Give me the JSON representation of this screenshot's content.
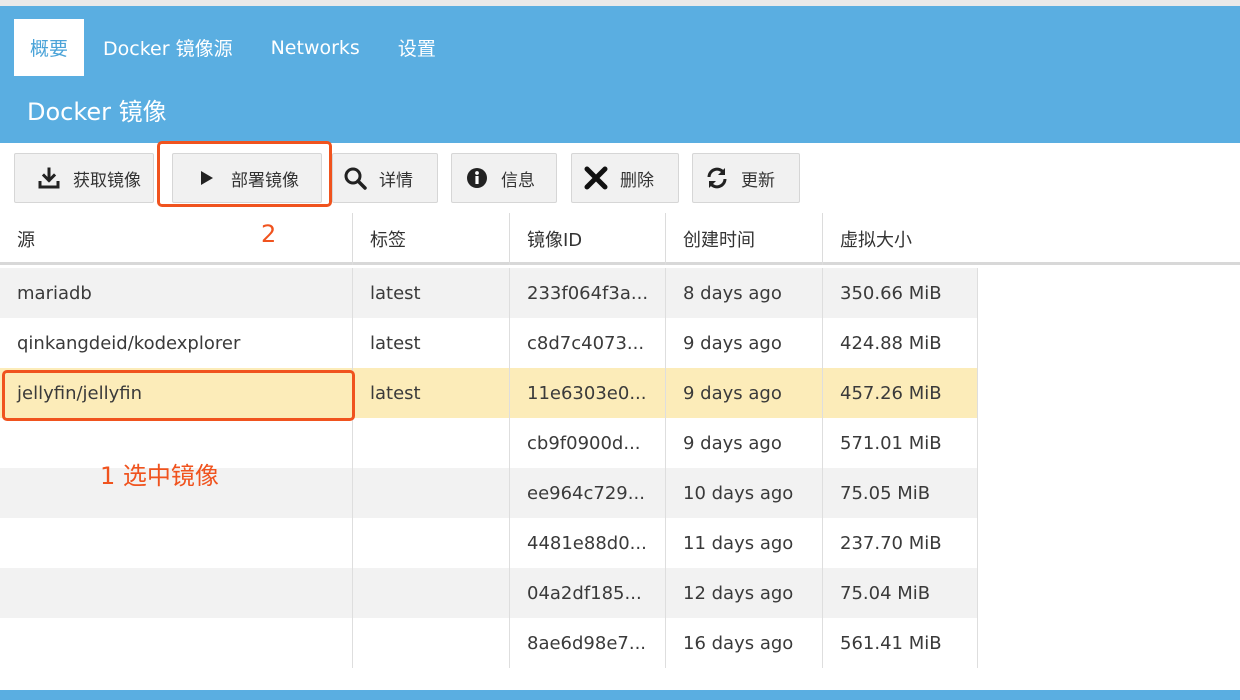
{
  "tabs": [
    {
      "label": "概要",
      "active": true
    },
    {
      "label": "Docker 镜像源",
      "active": false
    },
    {
      "label": "Networks",
      "active": false
    },
    {
      "label": "设置",
      "active": false
    }
  ],
  "header": {
    "title": "Docker 镜像"
  },
  "toolbar": {
    "pull_label": "获取镜像",
    "deploy_label": "部署镜像",
    "details_label": "详情",
    "info_label": "信息",
    "delete_label": "删除",
    "update_label": "更新"
  },
  "table": {
    "columns": [
      "源",
      "标签",
      "镜像ID",
      "创建时间",
      "虚拟大小"
    ],
    "rows": [
      {
        "source": "mariadb",
        "tag": "latest",
        "id": "233f064f3a...",
        "created": "8 days ago",
        "size": "350.66 MiB",
        "selected": false
      },
      {
        "source": "qinkangdeid/kodexplorer",
        "tag": "latest",
        "id": "c8d7c4073...",
        "created": "9 days ago",
        "size": "424.88 MiB",
        "selected": false
      },
      {
        "source": "jellyfin/jellyfin",
        "tag": "latest",
        "id": "11e6303e0...",
        "created": "9 days ago",
        "size": "457.26 MiB",
        "selected": true
      },
      {
        "source": "",
        "tag": "",
        "id": "cb9f0900d...",
        "created": "9 days ago",
        "size": "571.01 MiB",
        "selected": false
      },
      {
        "source": "",
        "tag": "",
        "id": "ee964c729...",
        "created": "10 days ago",
        "size": "75.05 MiB",
        "selected": false
      },
      {
        "source": "",
        "tag": "",
        "id": "4481e88d0...",
        "created": "11 days ago",
        "size": "237.70 MiB",
        "selected": false
      },
      {
        "source": "",
        "tag": "",
        "id": "04a2df185...",
        "created": "12 days ago",
        "size": "75.04 MiB",
        "selected": false
      },
      {
        "source": "",
        "tag": "",
        "id": "8ae6d98e7...",
        "created": "16 days ago",
        "size": "561.41 MiB",
        "selected": false
      }
    ]
  },
  "annotations": {
    "step1": "1 选中镜像",
    "step2": "2"
  },
  "colors": {
    "header_bg": "#5aaee1",
    "selected_row": "#fcecb9",
    "annotation": "#f0531e"
  },
  "icons": {
    "pull": "download-icon",
    "deploy": "play-icon",
    "details": "search-icon",
    "info": "info-icon",
    "delete": "close-icon",
    "update": "refresh-icon"
  }
}
